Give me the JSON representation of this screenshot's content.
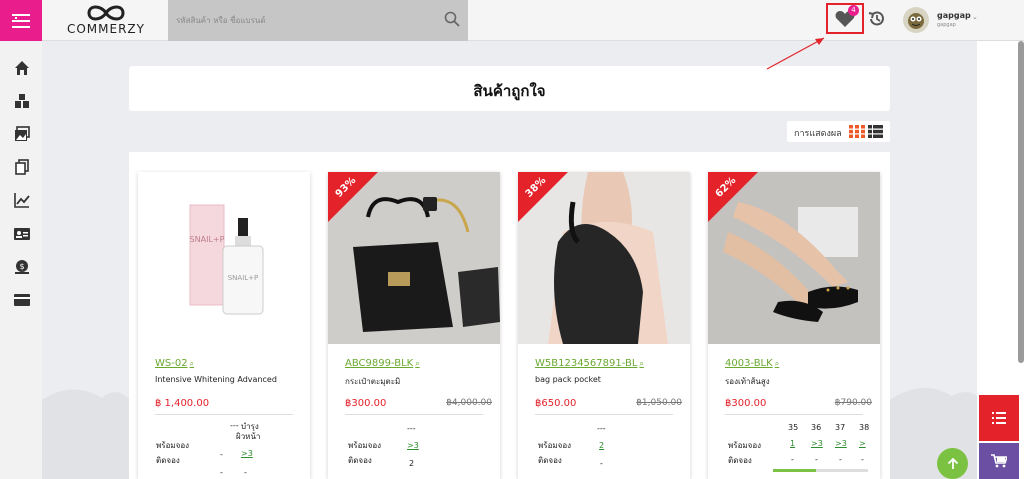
{
  "header": {
    "logo_text": "COMMERZY",
    "search_placeholder": "รหัสสินค้า หรือ ชื่อแบรนด์",
    "wishlist_count": "4",
    "user_name": "gapgap",
    "user_sub": "gapgap"
  },
  "icons": {
    "menu": "menu-icon",
    "search": "search-icon",
    "wishlist": "heart-icon",
    "history": "history-icon",
    "sidebar": [
      "home-icon",
      "boxes-icon",
      "images-icon",
      "copy-icon",
      "chart-line-icon",
      "id-card-icon",
      "money-icon",
      "credit-card-icon"
    ]
  },
  "page": {
    "title": "สินค้าถูกใจ",
    "view_label": "การแสดงผล"
  },
  "colors": {
    "accent_pink": "#e91e8c",
    "sale_red": "#e3222a",
    "link_green": "#6aa82f",
    "fab_purple": "#6a4fa3"
  },
  "products": [
    {
      "sku": "WS-02",
      "name": "Intensive Whitening Advanced",
      "price": "฿ 1,400.00",
      "old_price": "",
      "discount": "",
      "stock_header": [
        "---",
        "บำรุง",
        "ผิวหน้า"
      ],
      "label_ready": "พร้อมจอง",
      "label_booked": "ติดจอง",
      "ready_vals": [
        "-",
        ">3"
      ],
      "booked_vals": [
        "-",
        "-"
      ]
    },
    {
      "sku": "ABC9899-BLK",
      "name": "กระเป๋าตะมุตะมิ",
      "price": "฿300.00",
      "old_price": "฿4,000.00",
      "discount": "93%",
      "stock_header": [
        "---"
      ],
      "label_ready": "พร้อมจอง",
      "label_booked": "ติดจอง",
      "ready_vals": [
        ">3"
      ],
      "booked_vals": [
        "2"
      ]
    },
    {
      "sku": "W5B1234567891-BL",
      "name": "bag pack pocket",
      "price": "฿650.00",
      "old_price": "฿1,050.00",
      "discount": "38%",
      "stock_header": [
        "---"
      ],
      "label_ready": "พร้อมจอง",
      "label_booked": "ติดจอง",
      "ready_vals": [
        "2"
      ],
      "booked_vals": [
        "-"
      ]
    },
    {
      "sku": "4003-BLK",
      "name": "รองเท้าส้นสูง",
      "price": "฿300.00",
      "old_price": "฿790.00",
      "discount": "62%",
      "stock_header": [
        "35",
        "36",
        "37",
        "38"
      ],
      "label_ready": "พร้อมจอง",
      "label_booked": "ติดจอง",
      "ready_vals": [
        "1",
        ">3",
        ">3",
        ">"
      ],
      "booked_vals": [
        "-",
        "-",
        "-",
        "-"
      ],
      "scroll_progress": 0.45
    }
  ]
}
